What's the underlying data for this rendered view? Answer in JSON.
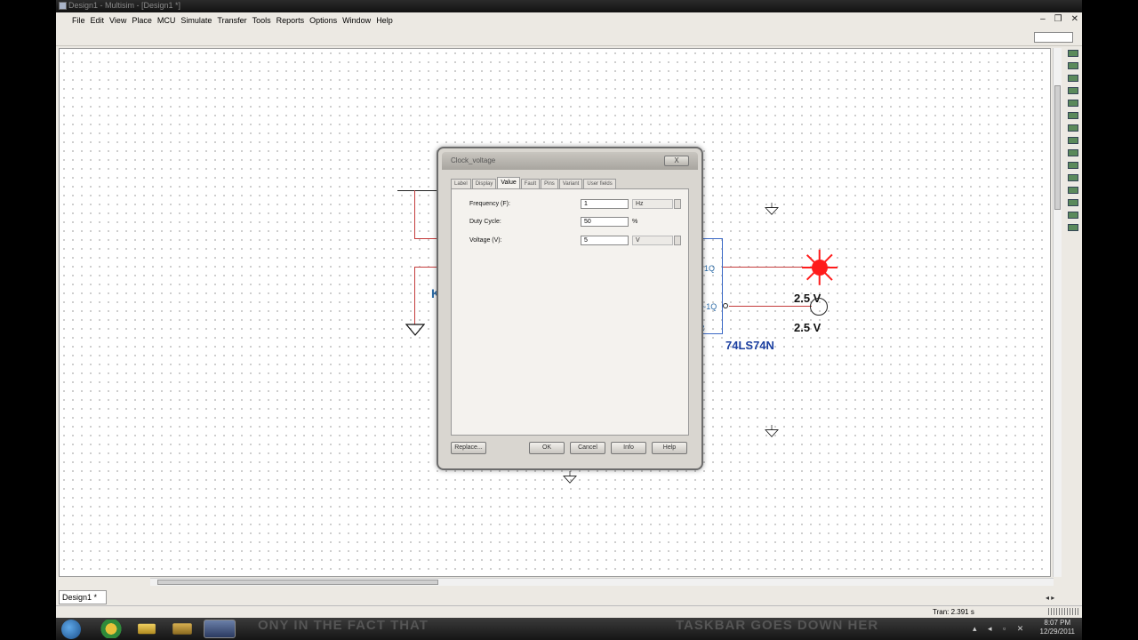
{
  "window": {
    "title": "Design1 - Multisim - [Design1 *]"
  },
  "menu": [
    "File",
    "Edit",
    "View",
    "Place",
    "MCU",
    "Simulate",
    "Transfer",
    "Tools",
    "Reports",
    "Options",
    "Window",
    "Help"
  ],
  "schematic": {
    "part_label": "74LS74N",
    "pin_1q": "1Q",
    "pin_1q_bar": "~1Q",
    "pin_r": "R",
    "probe_top": "2.5 V",
    "probe_bottom": "2.5 V",
    "k_letter": "K"
  },
  "dialog": {
    "title": "Clock_voltage",
    "close_label": "X",
    "tabs": [
      "Label",
      "Display",
      "Value",
      "Fault",
      "Pins",
      "Variant",
      "User fields"
    ],
    "active_tab": "Value",
    "fields": [
      {
        "label": "Frequency (F):",
        "value": "1",
        "unit": "Hz"
      },
      {
        "label": "Duty Cycle:",
        "value": "50",
        "unit": "%"
      },
      {
        "label": "Voltage (V):",
        "value": "5",
        "unit": "V"
      }
    ],
    "buttons": {
      "replace": "Replace...",
      "ok": "OK",
      "cancel": "Cancel",
      "info": "Info",
      "help": "Help"
    }
  },
  "tabs_bottom": {
    "design_tab": "Design1 *"
  },
  "status": {
    "tran": "Tran: 2.391 s"
  },
  "taskbar": {
    "clock_time": "8:07 PM",
    "clock_date": "12/29/2011",
    "overlay_left": "ONY IN THE FACT THAT",
    "overlay_right": "TASKBAR GOES DOWN HER"
  }
}
